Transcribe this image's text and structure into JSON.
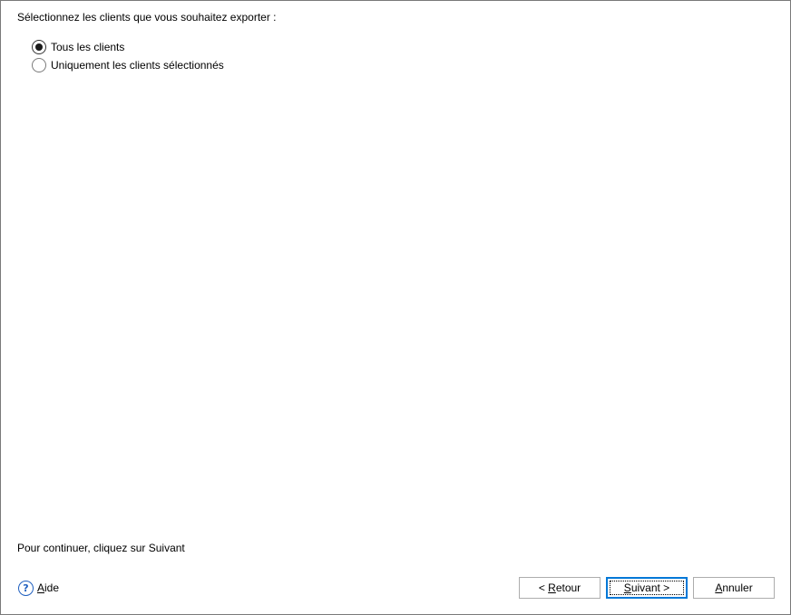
{
  "prompt": "Sélectionnez les clients que vous souhaitez exporter :",
  "options": [
    {
      "label": "Tous les clients",
      "checked": true
    },
    {
      "label": "Uniquement les clients sélectionnés",
      "checked": false
    }
  ],
  "hint": "Pour continuer, cliquez sur Suivant",
  "help": {
    "icon": "help-icon",
    "glyph": "?",
    "label_mnemonic": "A",
    "label_rest": "ide"
  },
  "buttons": {
    "back": {
      "prefix": "< ",
      "mnemonic": "R",
      "rest": "etour"
    },
    "next": {
      "mnemonic": "S",
      "rest": "uivant >"
    },
    "cancel": {
      "mnemonic": "A",
      "rest": "nnuler"
    }
  },
  "colors": {
    "accent": "#0078d7",
    "help": "#1f5fbf"
  }
}
